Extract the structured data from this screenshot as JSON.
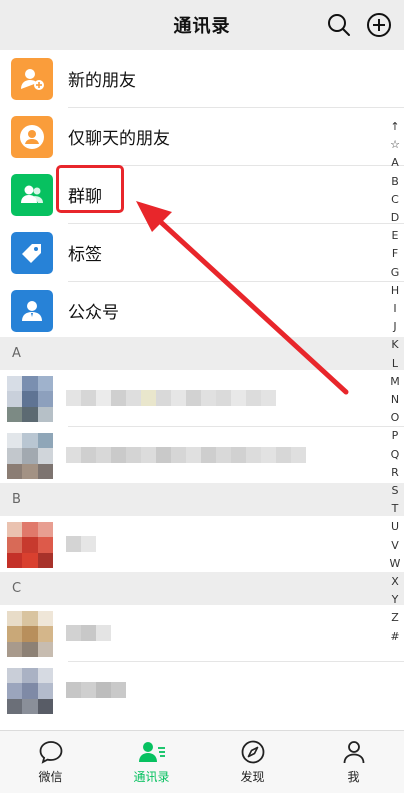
{
  "header": {
    "title": "通讯录",
    "search_icon": "search-icon",
    "add_icon": "plus-circle-icon"
  },
  "functions": [
    {
      "label": "新的朋友",
      "icon": "add-friend-icon",
      "color": "#fa9d3b"
    },
    {
      "label": "仅聊天的朋友",
      "icon": "chat-only-friend-icon",
      "color": "#fa9d3b"
    },
    {
      "label": "群聊",
      "icon": "group-chat-icon",
      "color": "#07c160"
    },
    {
      "label": "标签",
      "icon": "tag-icon",
      "color": "#2782d7"
    },
    {
      "label": "公众号",
      "icon": "official-account-icon",
      "color": "#2782d7"
    }
  ],
  "sections": [
    {
      "letter": "A"
    },
    {
      "letter": "B"
    },
    {
      "letter": "C"
    }
  ],
  "alpha_index": [
    "↑",
    "☆",
    "A",
    "B",
    "C",
    "D",
    "E",
    "F",
    "G",
    "H",
    "I",
    "J",
    "K",
    "L",
    "M",
    "N",
    "O",
    "P",
    "Q",
    "R",
    "S",
    "T",
    "U",
    "V",
    "W",
    "X",
    "Y",
    "Z",
    "#"
  ],
  "tabs": [
    {
      "label": "微信",
      "icon": "chat-bubble-icon"
    },
    {
      "label": "通讯录",
      "icon": "contacts-icon"
    },
    {
      "label": "发现",
      "icon": "compass-icon"
    },
    {
      "label": "我",
      "icon": "person-icon"
    }
  ],
  "colors": {
    "accent": "#07c160",
    "annotation": "#e8262b"
  }
}
